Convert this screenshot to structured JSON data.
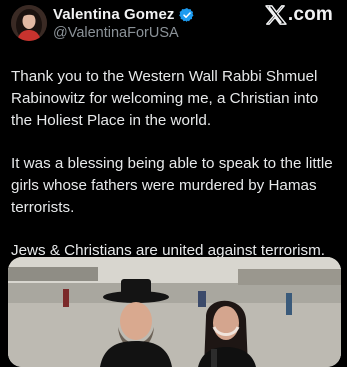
{
  "author": {
    "display_name": "Valentina Gomez",
    "handle": "@ValentinaForUSA",
    "verified": true,
    "verified_icon": "verified-badge-icon",
    "avatar_icon": "profile-avatar"
  },
  "brand": {
    "label": ".com",
    "icon": "x-logo-icon"
  },
  "tweet": {
    "paragraphs": [
      "Thank you to the Western Wall Rabbi Shmuel Rabinowitz for welcoming me, a Christian into the Holiest Place in the world.",
      "It was a blessing being able to speak to the little girls whose fathers were murdered by Hamas terrorists.",
      "Jews & Christians are united against terrorism."
    ]
  },
  "media": {
    "type": "video-thumbnail",
    "icon": "video-thumbnail-image"
  },
  "colors": {
    "background": "#000000",
    "text": "#e7e9ea",
    "secondary_text": "#8b9298",
    "verified_blue": "#1d9bf0"
  }
}
